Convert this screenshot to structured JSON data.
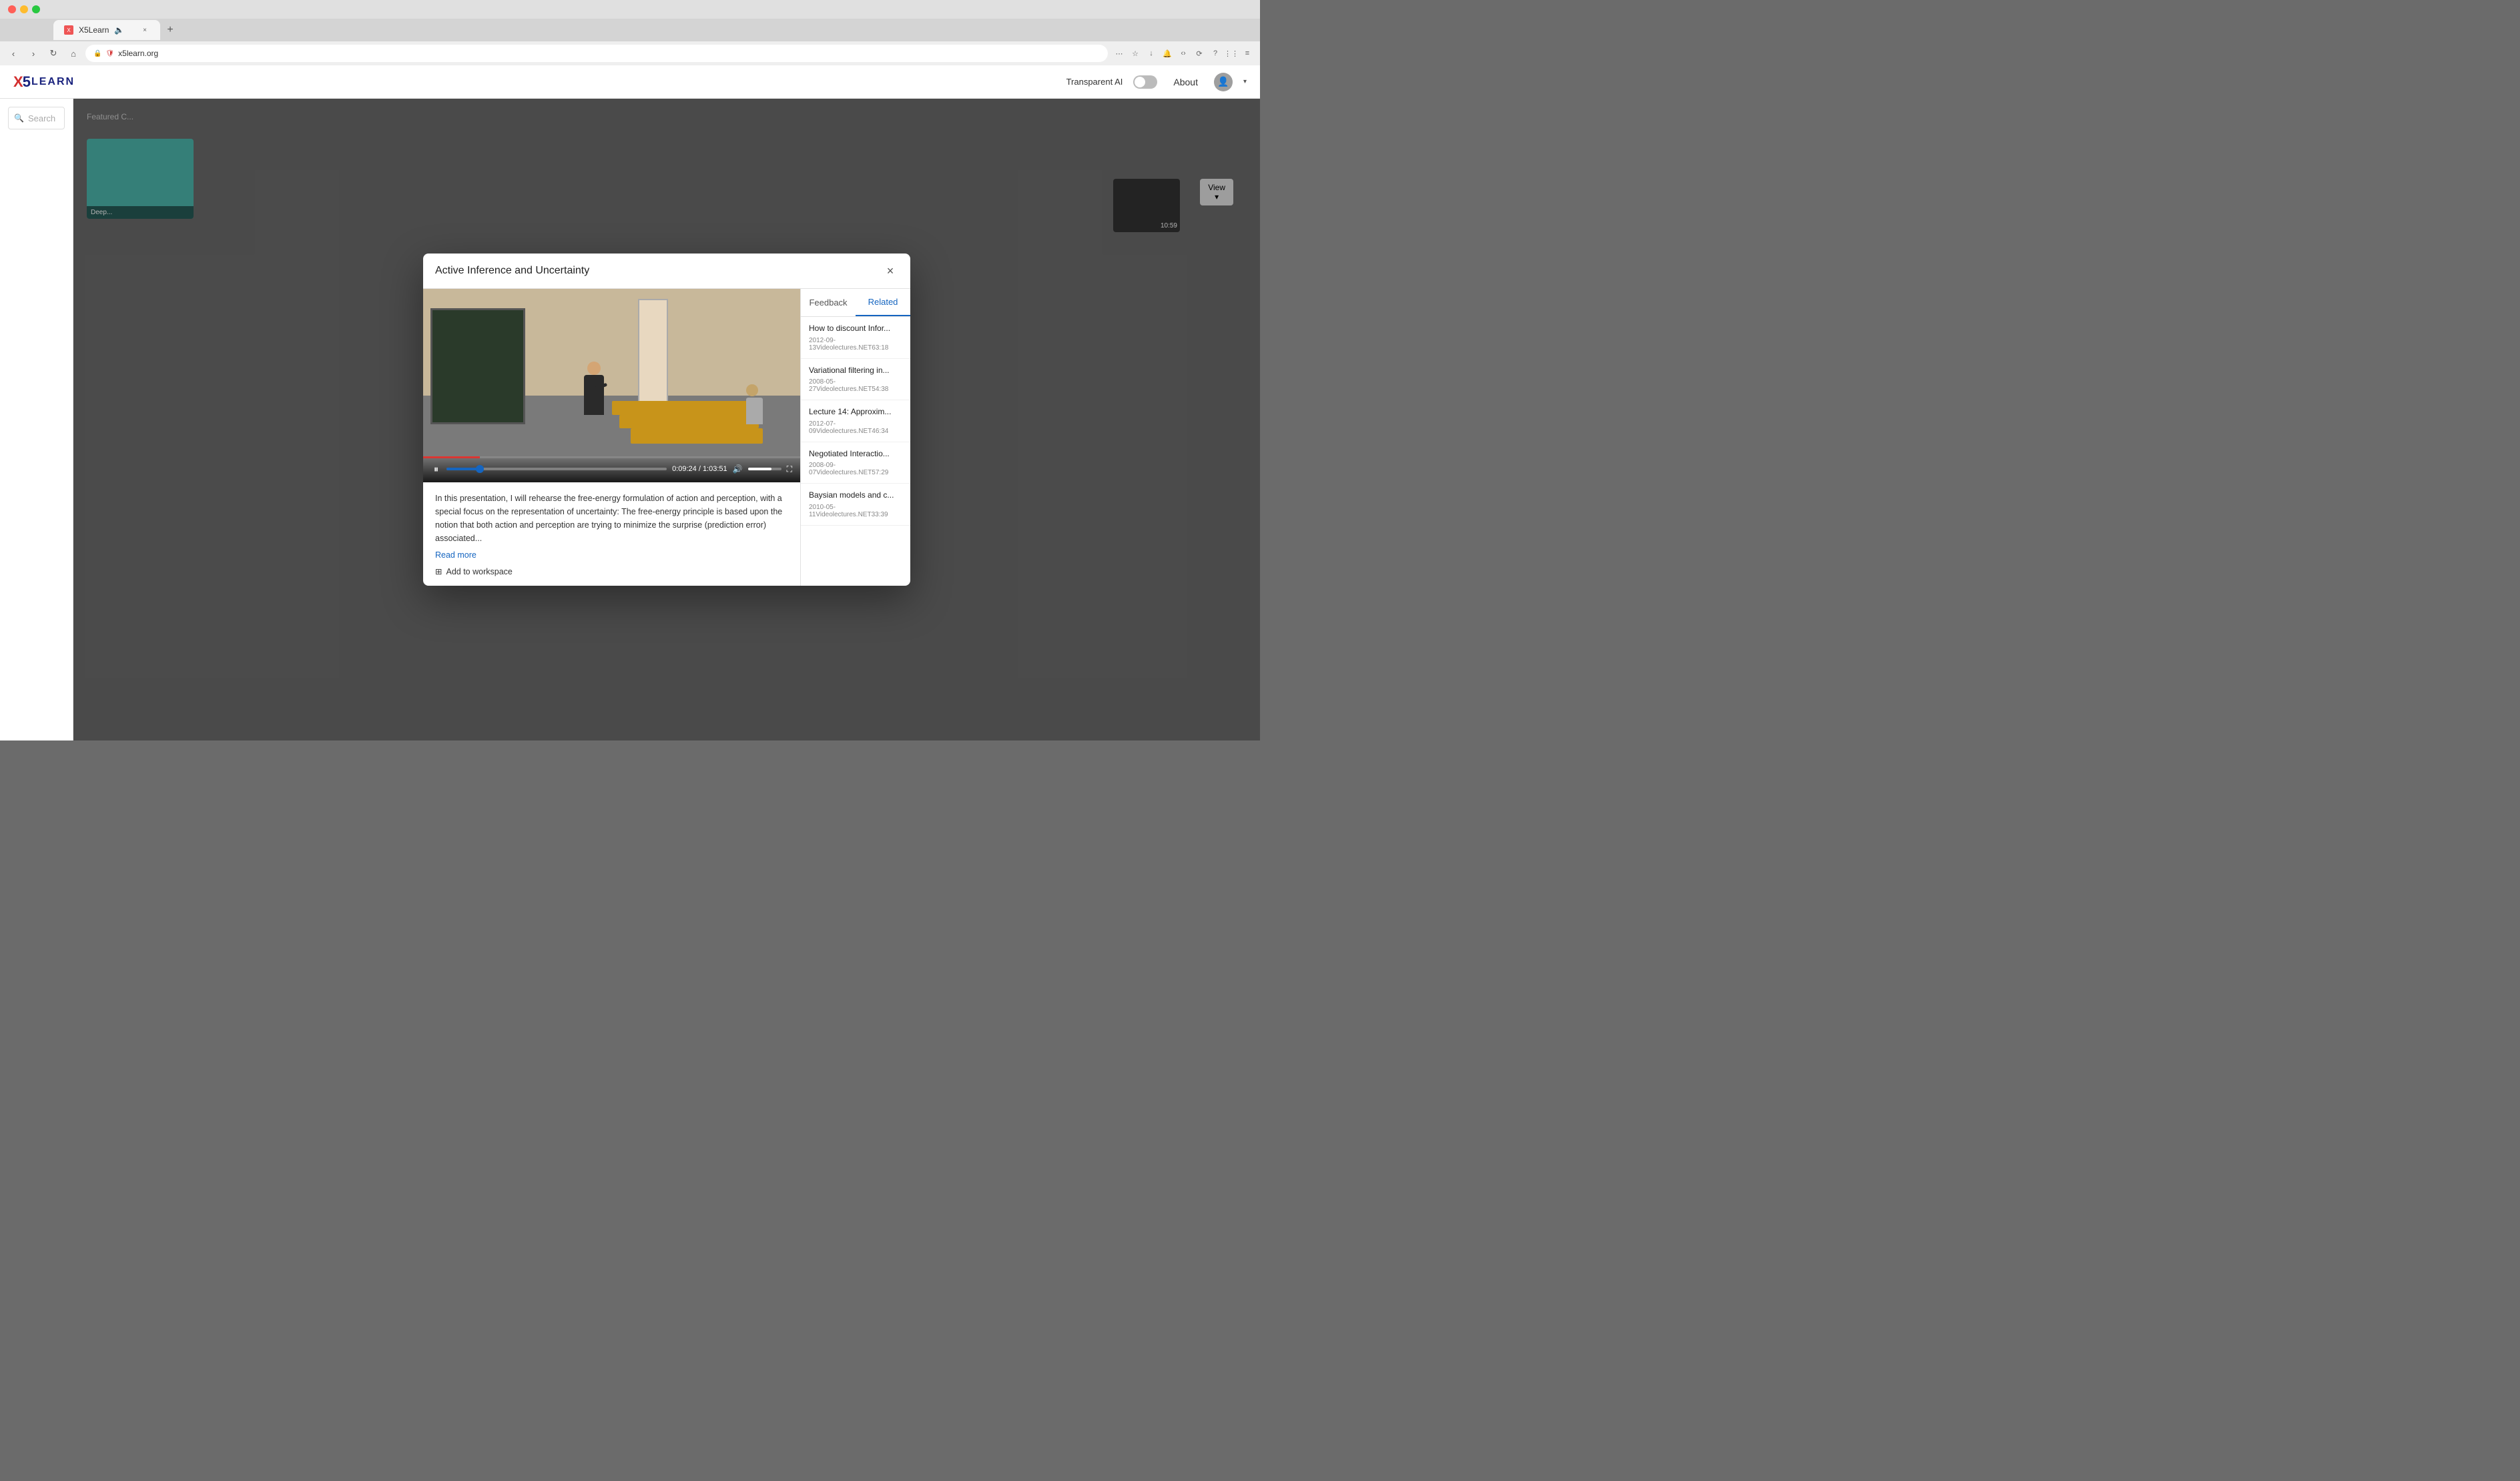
{
  "browser": {
    "tab_label": "X5Learn",
    "url": "x5learn.org",
    "new_tab_icon": "+"
  },
  "header": {
    "logo_x": "X",
    "logo_5": "5",
    "logo_learn": "LEARN",
    "transparent_ai_label": "Transparent AI",
    "about_label": "About",
    "toggle_state": "off"
  },
  "sidebar": {
    "search_placeholder": "Search"
  },
  "modal": {
    "title": "Active Inference and Uncertainty",
    "close_label": "×",
    "tabs": {
      "feedback": "Feedback",
      "related": "Related"
    },
    "video": {
      "current_time": "0:09:24",
      "total_time": "1:03:51"
    },
    "description": "In this presentation, I will rehearse the free-energy formulation of action and perception, with a special focus on the representation of uncertainty: The free-energy principle is based upon the notion that both action and perception are trying to minimize the surprise (prediction error) associated...",
    "read_more": "Read more",
    "add_workspace": "Add to workspace",
    "related_items": [
      {
        "title": "How to discount Infor...",
        "meta": "2012-09-13Videolectures.NET63:18"
      },
      {
        "title": "Variational filtering in...",
        "meta": "2008-05-27Videolectures.NET54:38"
      },
      {
        "title": "Lecture 14: Approxim...",
        "meta": "2012-07-09Videolectures.NET46:34"
      },
      {
        "title": "Negotiated Interactio...",
        "meta": "2008-09-07Videolectures.NET57:29"
      },
      {
        "title": "Baysian models and c...",
        "meta": "2010-05-11Videolectures.NET33:39"
      }
    ]
  },
  "featured": {
    "label": "Featured C...",
    "card_label": "Deep...",
    "view_label": "View ▾",
    "card_time": "10:59"
  }
}
